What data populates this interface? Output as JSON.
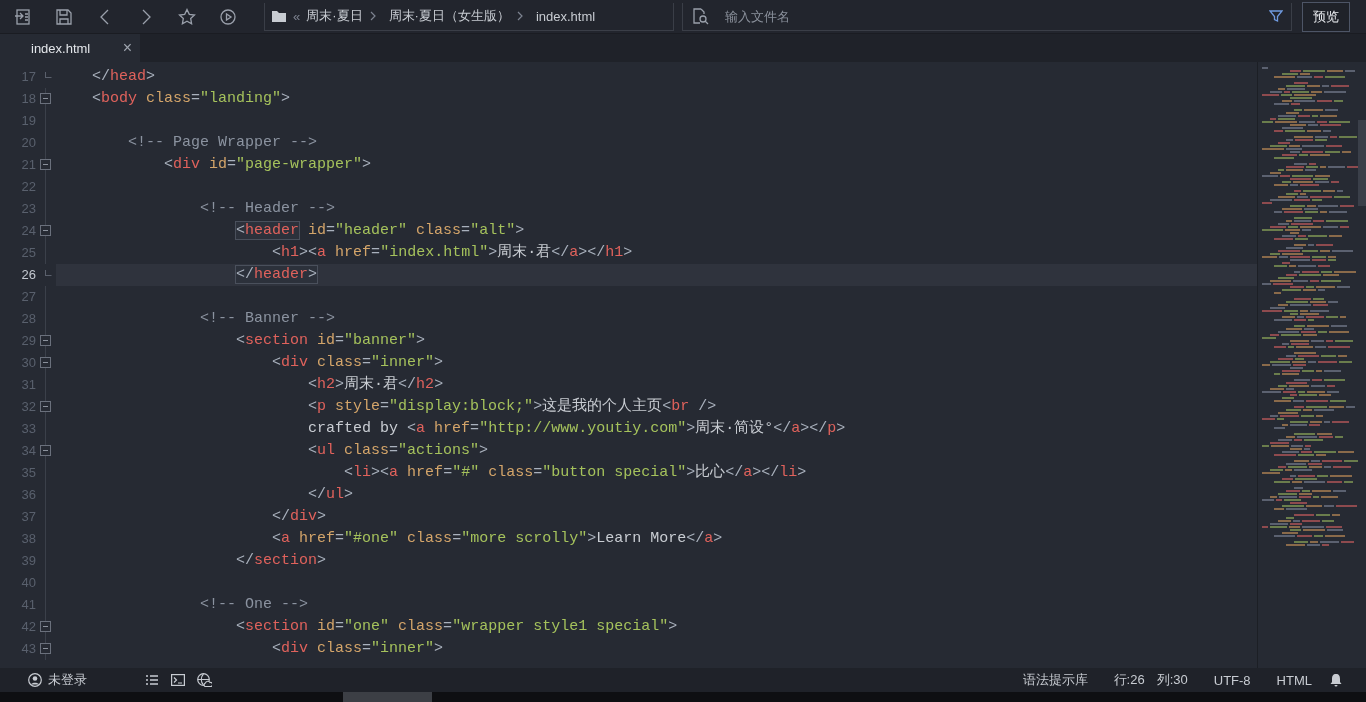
{
  "toolbar": {
    "breadcrumb_more": "«",
    "breadcrumb": [
      "周末·夏日",
      "周末·夏日（女生版）",
      "index.html"
    ],
    "search": {
      "placeholder": "输入文件名"
    },
    "preview_button": "预览"
  },
  "tabs": [
    {
      "label": "index.html",
      "close": "×",
      "selected": true
    }
  ],
  "editor": {
    "lines": [
      {
        "number": "17",
        "kind": "foldend",
        "current": false,
        "tokens": [
          {
            "kind": "punct",
            "text": "</"
          },
          {
            "kind": "tag",
            "text": "head"
          },
          {
            "kind": "punct",
            "text": ">"
          }
        ]
      },
      {
        "number": "18",
        "kind": "foldstart",
        "current": false,
        "tokens": [
          {
            "kind": "punct",
            "text": "<"
          },
          {
            "kind": "tag",
            "text": "body"
          },
          {
            "kind": "attr",
            "text": " class"
          },
          {
            "kind": "punct",
            "text": "="
          },
          {
            "kind": "string",
            "text": "\"landing\""
          },
          {
            "kind": "punct",
            "text": ">"
          }
        ],
        "children": [
          {
            "number": "19",
            "kind": "plain",
            "current": false
          },
          {
            "number": "20",
            "kind": "plain",
            "current": false,
            "tokens": [
              {
                "kind": "comment",
                "text": "<!-- Page Wrapper -->"
              }
            ],
            "children": [
              {
                "number": "21",
                "kind": "foldstart",
                "current": false,
                "tokens": [
                  {
                    "kind": "punct",
                    "text": "<"
                  },
                  {
                    "kind": "tag",
                    "text": "div"
                  },
                  {
                    "kind": "attr",
                    "text": " id"
                  },
                  {
                    "kind": "punct",
                    "text": "="
                  },
                  {
                    "kind": "string",
                    "text": "\"page-wrapper\""
                  },
                  {
                    "kind": "punct",
                    "text": ">"
                  }
                ],
                "children": [
                  {
                    "number": "22",
                    "kind": "plain",
                    "current": false
                  },
                  {
                    "number": "23",
                    "kind": "plain",
                    "current": false,
                    "tokens": [
                      {
                        "kind": "comment",
                        "text": "<!-- Header -->"
                      }
                    ],
                    "children": [
                      {
                        "number": "24",
                        "kind": "foldstart",
                        "current": false,
                        "tokens": [
                          {
                            "kind": "box",
                            "tokens": [
                              {
                                "kind": "punct",
                                "text": "<"
                              },
                              {
                                "kind": "tag",
                                "text": "header"
                              }
                            ]
                          },
                          {
                            "kind": "attr",
                            "text": " id"
                          },
                          {
                            "kind": "punct",
                            "text": "="
                          },
                          {
                            "kind": "string",
                            "text": "\"header\""
                          },
                          {
                            "kind": "attr",
                            "text": " class"
                          },
                          {
                            "kind": "punct",
                            "text": "="
                          },
                          {
                            "kind": "string",
                            "text": "\"alt\""
                          },
                          {
                            "kind": "punct",
                            "text": ">"
                          }
                        ],
                        "children": [
                          {
                            "number": "25",
                            "kind": "plain",
                            "current": false,
                            "tokens": [
                              {
                                "kind": "punct",
                                "text": "<"
                              },
                              {
                                "kind": "tag",
                                "text": "h1"
                              },
                              {
                                "kind": "punct",
                                "text": "><"
                              },
                              {
                                "kind": "tag",
                                "text": "a"
                              },
                              {
                                "kind": "attr",
                                "text": " href"
                              },
                              {
                                "kind": "punct",
                                "text": "="
                              },
                              {
                                "kind": "string",
                                "text": "\"index.html\""
                              },
                              {
                                "kind": "punct",
                                "text": ">"
                              },
                              {
                                "kind": "text",
                                "text": "周末·君"
                              },
                              {
                                "kind": "punct",
                                "text": "</"
                              },
                              {
                                "kind": "tag",
                                "text": "a"
                              },
                              {
                                "kind": "punct",
                                "text": "></"
                              },
                              {
                                "kind": "tag",
                                "text": "h1"
                              },
                              {
                                "kind": "punct",
                                "text": ">"
                              }
                            ]
                          }
                        ]
                      },
                      {
                        "number": "26",
                        "kind": "foldend",
                        "current": true,
                        "tokens": [
                          {
                            "kind": "box",
                            "tokens": [
                              {
                                "kind": "punct",
                                "text": "</"
                              },
                              {
                                "kind": "tag",
                                "text": "header"
                              },
                              {
                                "kind": "punct",
                                "text": ">"
                              }
                            ]
                          }
                        ]
                      },
                      {
                        "number": "27",
                        "kind": "plain",
                        "current": false
                      }
                    ]
                  },
                  {
                    "number": "28",
                    "kind": "plain",
                    "current": false,
                    "tokens": [
                      {
                        "kind": "comment",
                        "text": "<!-- Banner -->"
                      }
                    ],
                    "children": [
                      {
                        "number": "29",
                        "kind": "foldstart",
                        "current": false,
                        "tokens": [
                          {
                            "kind": "punct",
                            "text": "<"
                          },
                          {
                            "kind": "tag",
                            "text": "section"
                          },
                          {
                            "kind": "attr",
                            "text": " id"
                          },
                          {
                            "kind": "punct",
                            "text": "="
                          },
                          {
                            "kind": "string",
                            "text": "\"banner\""
                          },
                          {
                            "kind": "punct",
                            "text": ">"
                          }
                        ],
                        "children": [
                          {
                            "number": "30",
                            "kind": "foldstart",
                            "current": false,
                            "tokens": [
                              {
                                "kind": "punct",
                                "text": "<"
                              },
                              {
                                "kind": "tag",
                                "text": "div"
                              },
                              {
                                "kind": "attr",
                                "text": " class"
                              },
                              {
                                "kind": "punct",
                                "text": "="
                              },
                              {
                                "kind": "string",
                                "text": "\"inner\""
                              },
                              {
                                "kind": "punct",
                                "text": ">"
                              }
                            ],
                            "children": [
                              {
                                "number": "31",
                                "kind": "plain",
                                "current": false,
                                "tokens": [
                                  {
                                    "kind": "punct",
                                    "text": "<"
                                  },
                                  {
                                    "kind": "tag",
                                    "text": "h2"
                                  },
                                  {
                                    "kind": "punct",
                                    "text": ">"
                                  },
                                  {
                                    "kind": "text",
                                    "text": "周末·君"
                                  },
                                  {
                                    "kind": "punct",
                                    "text": "</"
                                  },
                                  {
                                    "kind": "tag",
                                    "text": "h2"
                                  },
                                  {
                                    "kind": "punct",
                                    "text": ">"
                                  }
                                ]
                              },
                              {
                                "number": "32",
                                "kind": "foldstart",
                                "current": false,
                                "tokens": [
                                  {
                                    "kind": "punct",
                                    "text": "<"
                                  },
                                  {
                                    "kind": "tag",
                                    "text": "p"
                                  },
                                  {
                                    "kind": "attr",
                                    "text": " style"
                                  },
                                  {
                                    "kind": "punct",
                                    "text": "="
                                  },
                                  {
                                    "kind": "string",
                                    "text": "\"display:block;\""
                                  },
                                  {
                                    "kind": "punct",
                                    "text": ">"
                                  },
                                  {
                                    "kind": "text",
                                    "text": "这是我的个人主页"
                                  },
                                  {
                                    "kind": "punct",
                                    "text": "<"
                                  },
                                  {
                                    "kind": "tag",
                                    "text": "br"
                                  },
                                  {
                                    "kind": "punct",
                                    "text": " />"
                                  }
                                ]
                              },
                              {
                                "number": "33",
                                "kind": "plain",
                                "current": false,
                                "tokens": [
                                  {
                                    "kind": "text",
                                    "text": "crafted by "
                                  },
                                  {
                                    "kind": "punct",
                                    "text": "<"
                                  },
                                  {
                                    "kind": "tag",
                                    "text": "a"
                                  },
                                  {
                                    "kind": "attr",
                                    "text": " href"
                                  },
                                  {
                                    "kind": "punct",
                                    "text": "="
                                  },
                                  {
                                    "kind": "string",
                                    "text": "\"http://www.youtiy.com\""
                                  },
                                  {
                                    "kind": "punct",
                                    "text": ">"
                                  },
                                  {
                                    "kind": "text",
                                    "text": "周末·简设°"
                                  },
                                  {
                                    "kind": "punct",
                                    "text": "</"
                                  },
                                  {
                                    "kind": "tag",
                                    "text": "a"
                                  },
                                  {
                                    "kind": "punct",
                                    "text": "></"
                                  },
                                  {
                                    "kind": "tag",
                                    "text": "p"
                                  },
                                  {
                                    "kind": "punct",
                                    "text": ">"
                                  }
                                ]
                              },
                              {
                                "number": "34",
                                "kind": "foldstart",
                                "current": false,
                                "tokens": [
                                  {
                                    "kind": "punct",
                                    "text": "<"
                                  },
                                  {
                                    "kind": "tag",
                                    "text": "ul"
                                  },
                                  {
                                    "kind": "attr",
                                    "text": " class"
                                  },
                                  {
                                    "kind": "punct",
                                    "text": "="
                                  },
                                  {
                                    "kind": "string",
                                    "text": "\"actions\""
                                  },
                                  {
                                    "kind": "punct",
                                    "text": ">"
                                  }
                                ],
                                "children": [
                                  {
                                    "number": "35",
                                    "kind": "plain",
                                    "current": false,
                                    "tokens": [
                                      {
                                        "kind": "punct",
                                        "text": "<"
                                      },
                                      {
                                        "kind": "tag",
                                        "text": "li"
                                      },
                                      {
                                        "kind": "punct",
                                        "text": "><"
                                      },
                                      {
                                        "kind": "tag",
                                        "text": "a"
                                      },
                                      {
                                        "kind": "attr",
                                        "text": " href"
                                      },
                                      {
                                        "kind": "punct",
                                        "text": "="
                                      },
                                      {
                                        "kind": "string",
                                        "text": "\"#\""
                                      },
                                      {
                                        "kind": "attr",
                                        "text": " class"
                                      },
                                      {
                                        "kind": "punct",
                                        "text": "="
                                      },
                                      {
                                        "kind": "string",
                                        "text": "\"button special\""
                                      },
                                      {
                                        "kind": "punct",
                                        "text": ">"
                                      },
                                      {
                                        "kind": "text",
                                        "text": "比心"
                                      },
                                      {
                                        "kind": "punct",
                                        "text": "</"
                                      },
                                      {
                                        "kind": "tag",
                                        "text": "a"
                                      },
                                      {
                                        "kind": "punct",
                                        "text": "></"
                                      },
                                      {
                                        "kind": "tag",
                                        "text": "li"
                                      },
                                      {
                                        "kind": "punct",
                                        "text": ">"
                                      }
                                    ]
                                  }
                                ]
                              },
                              {
                                "number": "36",
                                "kind": "plain",
                                "current": false,
                                "tokens": [
                                  {
                                    "kind": "punct",
                                    "text": "</"
                                  },
                                  {
                                    "kind": "tag",
                                    "text": "ul"
                                  },
                                  {
                                    "kind": "punct",
                                    "text": ">"
                                  }
                                ]
                              }
                            ]
                          },
                          {
                            "number": "37",
                            "kind": "plain",
                            "current": false,
                            "tokens": [
                              {
                                "kind": "punct",
                                "text": "</"
                              },
                              {
                                "kind": "tag",
                                "text": "div"
                              },
                              {
                                "kind": "punct",
                                "text": ">"
                              }
                            ]
                          },
                          {
                            "number": "38",
                            "kind": "plain",
                            "current": false,
                            "tokens": [
                              {
                                "kind": "punct",
                                "text": "<"
                              },
                              {
                                "kind": "tag",
                                "text": "a"
                              },
                              {
                                "kind": "attr",
                                "text": " href"
                              },
                              {
                                "kind": "punct",
                                "text": "="
                              },
                              {
                                "kind": "string",
                                "text": "\"#one\""
                              },
                              {
                                "kind": "attr",
                                "text": " class"
                              },
                              {
                                "kind": "punct",
                                "text": "="
                              },
                              {
                                "kind": "string",
                                "text": "\"more scrolly\""
                              },
                              {
                                "kind": "punct",
                                "text": ">"
                              },
                              {
                                "kind": "text",
                                "text": "Learn More"
                              },
                              {
                                "kind": "punct",
                                "text": "</"
                              },
                              {
                                "kind": "tag",
                                "text": "a"
                              },
                              {
                                "kind": "punct",
                                "text": ">"
                              }
                            ]
                          }
                        ]
                      },
                      {
                        "number": "39",
                        "kind": "plain",
                        "current": false,
                        "tokens": [
                          {
                            "kind": "punct",
                            "text": "</"
                          },
                          {
                            "kind": "tag",
                            "text": "section"
                          },
                          {
                            "kind": "punct",
                            "text": ">"
                          }
                        ]
                      },
                      {
                        "number": "40",
                        "kind": "plain",
                        "current": false
                      }
                    ]
                  },
                  {
                    "number": "41",
                    "kind": "plain",
                    "current": false,
                    "tokens": [
                      {
                        "kind": "comment",
                        "text": "<!-- One -->"
                      }
                    ],
                    "children": [
                      {
                        "number": "42",
                        "kind": "foldstart",
                        "current": false,
                        "tokens": [
                          {
                            "kind": "punct",
                            "text": "<"
                          },
                          {
                            "kind": "tag",
                            "text": "section"
                          },
                          {
                            "kind": "attr",
                            "text": " id"
                          },
                          {
                            "kind": "punct",
                            "text": "="
                          },
                          {
                            "kind": "string",
                            "text": "\"one\""
                          },
                          {
                            "kind": "attr",
                            "text": " class"
                          },
                          {
                            "kind": "punct",
                            "text": "="
                          },
                          {
                            "kind": "string",
                            "text": "\"wrapper style1 special\""
                          },
                          {
                            "kind": "punct",
                            "text": ">"
                          }
                        ],
                        "children": [
                          {
                            "number": "43",
                            "kind": "foldstart",
                            "current": false,
                            "tokens": [
                              {
                                "kind": "punct",
                                "text": "<"
                              },
                              {
                                "kind": "tag",
                                "text": "div"
                              },
                              {
                                "kind": "attr",
                                "text": " class"
                              },
                              {
                                "kind": "punct",
                                "text": "="
                              },
                              {
                                "kind": "string",
                                "text": "\"inner\""
                              },
                              {
                                "kind": "punct",
                                "text": ">"
                              }
                            ]
                          }
                        ]
                      }
                    ]
                  }
                ]
              }
            ]
          }
        ]
      }
    ]
  },
  "status_bar": {
    "login": "未登录",
    "syntax_library": "语法提示库",
    "line": "行:26",
    "column": "列:30",
    "encoding": "UTF-8",
    "language": "HTML"
  }
}
